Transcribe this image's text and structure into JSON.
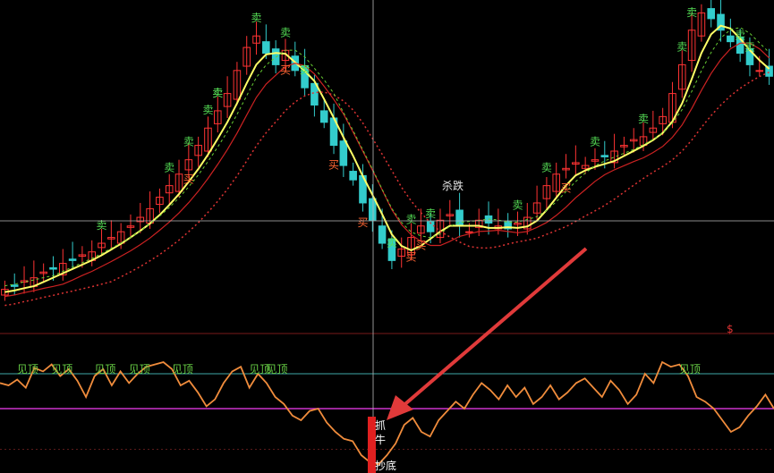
{
  "theme": {
    "background": "#000000",
    "up_candle": "#ff3333",
    "down_candle": "#33cccc",
    "ma_yellow": "#ffff66",
    "ma_red": "#cc2222",
    "ma_dotted_red": "#dd3333",
    "ma_dotted_green": "#66cc33",
    "oscillator": "#f08c3c",
    "level_cyan": "#3fa8a8",
    "level_magenta": "#cc33cc",
    "separator": "#7a1a1a",
    "crosshair": "#b8b8b8",
    "sell_text": "#55dd55",
    "buy_text": "#ff6633",
    "top_text": "#66cc44",
    "arrow": "#e03a3a"
  },
  "labels": {
    "dollar_marker": "$",
    "special_marker": "杀跌",
    "bottom_marker_1": "抓",
    "bottom_marker_2": "牛",
    "bottom_marker_3": "抄底"
  },
  "chart_data": [
    {
      "type": "candlestick",
      "panel": "price",
      "series_close_approx": [
        2,
        3,
        5,
        6,
        8,
        9,
        11,
        12,
        14,
        15,
        18,
        20,
        22,
        24,
        27,
        30,
        34,
        38,
        42,
        47,
        52,
        58,
        64,
        70,
        78,
        86,
        90,
        84,
        80,
        85,
        78,
        72,
        66,
        60,
        52,
        45,
        40,
        32,
        26,
        18,
        12,
        16,
        20,
        24,
        22,
        26,
        28,
        24,
        22,
        26,
        25,
        24,
        23,
        25,
        27,
        32,
        38,
        42,
        44,
        46,
        45,
        47,
        48,
        50,
        52,
        54,
        55,
        58,
        62,
        70,
        80,
        92,
        98,
        96,
        92,
        88,
        84,
        80,
        78,
        76
      ],
      "signals": [
        {
          "text": "卖",
          "kind": "sell",
          "i": 13
        },
        {
          "text": "卖",
          "kind": "sell",
          "i": 28
        },
        {
          "text": "卖",
          "kind": "sell",
          "i": 27
        },
        {
          "text": "卖",
          "kind": "sell",
          "i": 32
        },
        {
          "text": "卖",
          "kind": "sell",
          "i": 36
        },
        {
          "text": "卖",
          "kind": "sell",
          "i": 39
        },
        {
          "text": "卖",
          "kind": "sell",
          "i": 26
        },
        {
          "text": "卖",
          "kind": "sell",
          "i": 21
        },
        {
          "text": "卖",
          "kind": "sell",
          "i": 24
        },
        {
          "text": "卖",
          "kind": "sell",
          "i": 50
        },
        {
          "text": "卖",
          "kind": "sell",
          "i": 52
        },
        {
          "text": "卖",
          "kind": "sell",
          "i": 55
        },
        {
          "text": "卖",
          "kind": "sell",
          "i": 66
        },
        {
          "text": "卖",
          "kind": "sell",
          "i": 70
        },
        {
          "text": "卖",
          "kind": "sell",
          "i": 76
        },
        {
          "text": "卖",
          "kind": "sell",
          "i": 83
        },
        {
          "text": "卖",
          "kind": "sell",
          "i": 88
        },
        {
          "text": "卖",
          "kind": "sell",
          "i": 89
        },
        {
          "text": "卖",
          "kind": "sell",
          "i": 95
        },
        {
          "text": "卖",
          "kind": "sell",
          "i": 96
        },
        {
          "text": "买",
          "kind": "buy",
          "i": 24
        },
        {
          "text": "买",
          "kind": "buy",
          "i": 36
        },
        {
          "text": "买",
          "kind": "buy",
          "i": 43
        },
        {
          "text": "买",
          "kind": "buy",
          "i": 46
        },
        {
          "text": "买",
          "kind": "buy",
          "i": 53
        },
        {
          "text": "买",
          "kind": "buy",
          "i": 54
        },
        {
          "text": "买",
          "kind": "buy",
          "i": 72
        }
      ]
    },
    {
      "type": "line",
      "panel": "oscillator",
      "levels": {
        "upper": 80,
        "middle": 50
      },
      "values": [
        72,
        70,
        75,
        68,
        85,
        82,
        88,
        78,
        84,
        74,
        60,
        78,
        84,
        70,
        82,
        72,
        80,
        86,
        88,
        90,
        84,
        70,
        74,
        64,
        52,
        58,
        72,
        82,
        86,
        68,
        80,
        72,
        60,
        54,
        44,
        40,
        48,
        50,
        38,
        30,
        24,
        22,
        10,
        4,
        2,
        10,
        20,
        36,
        42,
        30,
        26,
        40,
        48,
        56,
        50,
        62,
        72,
        66,
        58,
        70,
        60,
        68,
        54,
        60,
        70,
        58,
        64,
        72,
        76,
        68,
        60,
        74,
        66,
        54,
        62,
        80,
        72,
        90,
        86,
        88,
        78,
        60,
        56,
        50,
        40,
        30,
        34,
        44,
        52,
        62,
        50
      ],
      "top_signals": [
        {
          "text": "见顶",
          "i": 3
        },
        {
          "text": "见顶",
          "i": 7
        },
        {
          "text": "见顶",
          "i": 12
        },
        {
          "text": "见顶",
          "i": 16
        },
        {
          "text": "见顶",
          "i": 21
        },
        {
          "text": "见顶",
          "i": 30
        },
        {
          "text": "见顶",
          "i": 32
        },
        {
          "text": "见顶",
          "i": 80
        }
      ]
    }
  ]
}
